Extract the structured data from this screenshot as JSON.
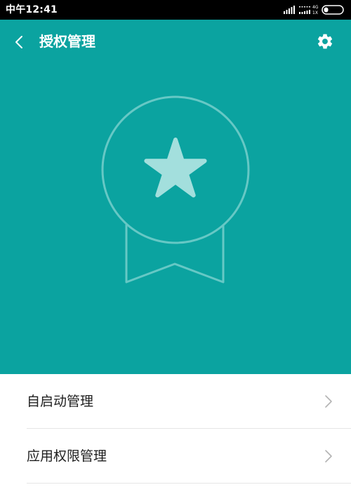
{
  "status_bar": {
    "time": "中午12:41",
    "network_label": "4G",
    "network_sub_label": "1X"
  },
  "header": {
    "title": "授权管理",
    "back_icon": "chevron-left-icon",
    "settings_icon": "gear-icon"
  },
  "hero": {
    "icon": "star-badge-icon"
  },
  "menu": {
    "items": [
      {
        "label": "自启动管理",
        "icon": "chevron-right-icon"
      },
      {
        "label": "应用权限管理",
        "icon": "chevron-right-icon"
      }
    ]
  },
  "colors": {
    "accent": "#0ba3a0",
    "badge_outline": "#66c8c5",
    "star_fill": "#a3dfdd",
    "status_bar": "#000000",
    "divider": "#e6e6e6"
  }
}
